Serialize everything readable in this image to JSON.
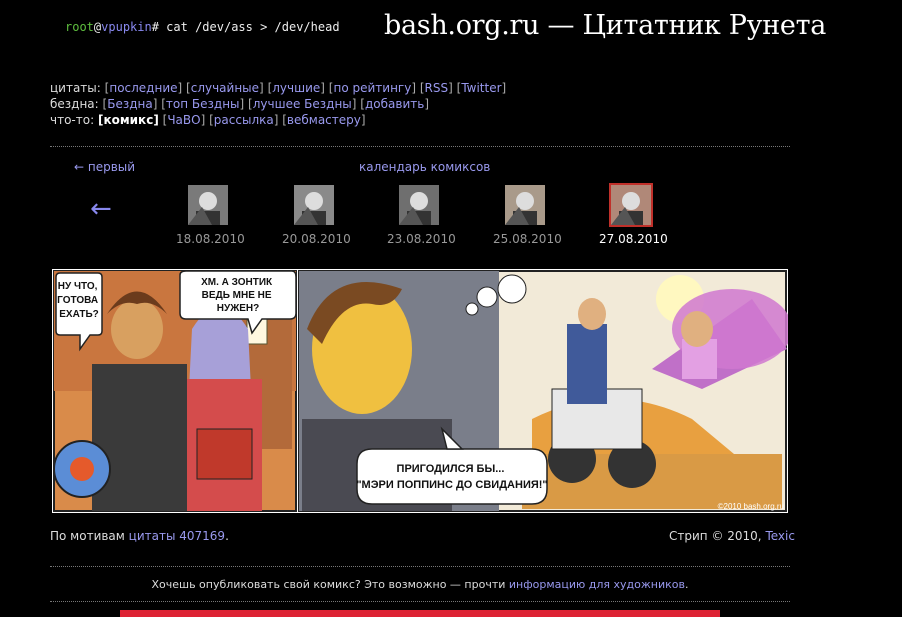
{
  "prompt": {
    "user": "root",
    "at": "@",
    "host": "vpupkin",
    "command": "# cat /dev/ass > /dev/head"
  },
  "site_title": "bash.org.ru — Цитатник Рунета",
  "nav": {
    "rows": [
      {
        "label": "цитаты:",
        "items": [
          "последние",
          "случайные",
          "лучшие",
          "по рейтингу",
          "RSS",
          "Twitter"
        ]
      },
      {
        "label": "бездна:",
        "items": [
          "Бездна",
          "топ Бездны",
          "лучшее Бездны",
          "добавить"
        ]
      },
      {
        "label": "что-то:",
        "current": "комикс",
        "items": [
          "ЧаВО",
          "рассылка",
          "вебмастеру"
        ]
      }
    ]
  },
  "comics_nav": {
    "first": "← первый",
    "calendar": "календарь комиксов",
    "back_arrow": "←",
    "thumbs": [
      {
        "date": "18.08.2010"
      },
      {
        "date": "20.08.2010"
      },
      {
        "date": "23.08.2010"
      },
      {
        "date": "25.08.2010"
      },
      {
        "date": "27.08.2010",
        "current": true
      }
    ]
  },
  "comic": {
    "bubble1": [
      "НУ ЧТО,",
      "ГОТОВА",
      "ЕХАТЬ?"
    ],
    "bubble2": [
      "ХМ. А ЗОНТИК",
      "ВЕДЬ МНЕ НЕ",
      "НУЖЕН?"
    ],
    "bubble3": [
      "ПРИГОДИЛСЯ БЫ...",
      "\"МЭРИ ПОППИНС ДО СВИДАНИЯ!\""
    ],
    "copyright": "©2010 bash.org.ru"
  },
  "credits": {
    "left_prefix": "По мотивам ",
    "left_link": "цитаты 407169",
    "left_suffix": ".",
    "right_prefix": "Стрип © 2010, ",
    "right_link": "Texic"
  },
  "publish": {
    "prefix": "Хочешь опубликовать свой комикс? Это возможно — прочти ",
    "link": "информацию для художников",
    "suffix": "."
  }
}
